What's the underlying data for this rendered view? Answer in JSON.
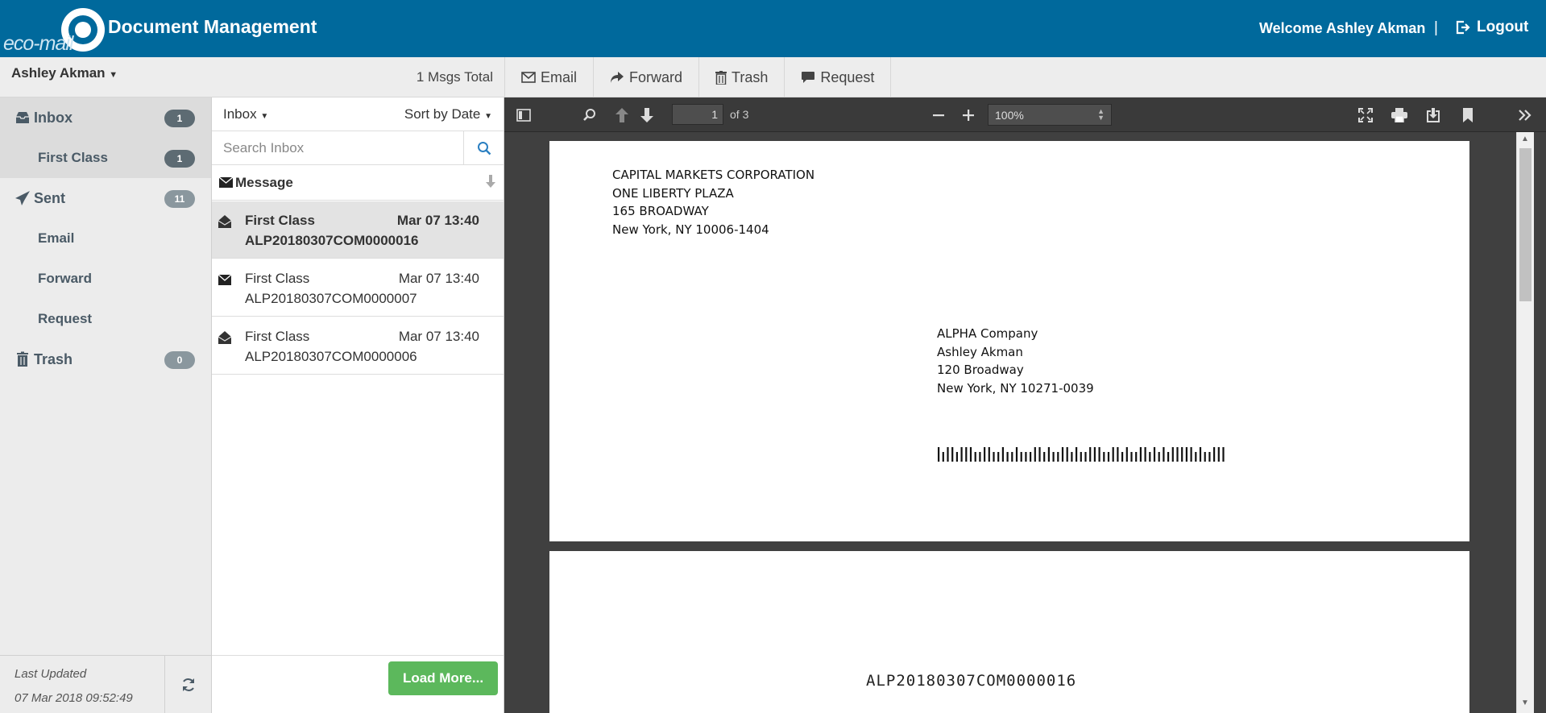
{
  "header": {
    "logo_text": "eco-mail",
    "title": "Document Management",
    "welcome": "Welcome Ashley Akman",
    "separator": "|",
    "logout": "Logout"
  },
  "toolbar": {
    "user": "Ashley Akman",
    "msgs_total": "1 Msgs Total",
    "actions": {
      "email": "Email",
      "forward": "Forward",
      "trash": "Trash",
      "request": "Request"
    }
  },
  "sidebar": {
    "inbox": {
      "label": "Inbox",
      "count": "1"
    },
    "first_class": {
      "label": "First Class",
      "count": "1"
    },
    "sent": {
      "label": "Sent",
      "count": "11"
    },
    "email": {
      "label": "Email"
    },
    "forward": {
      "label": "Forward"
    },
    "request": {
      "label": "Request"
    },
    "trash": {
      "label": "Trash",
      "count": "0"
    },
    "last_updated_label": "Last Updated",
    "last_updated_value": "07 Mar 2018 09:52:49"
  },
  "list": {
    "folder": "Inbox",
    "sort": "Sort by Date",
    "search_placeholder": "Search Inbox",
    "column": "Message",
    "rows": [
      {
        "title": "First Class",
        "date": "Mar 07 13:40",
        "id": "ALP20180307COM0000016",
        "read": true
      },
      {
        "title": "First Class",
        "date": "Mar 07 13:40",
        "id": "ALP20180307COM0000007",
        "read": false
      },
      {
        "title": "First Class",
        "date": "Mar 07 13:40",
        "id": "ALP20180307COM0000006",
        "read": true
      }
    ],
    "load_more": "Load More..."
  },
  "viewer": {
    "page_number": "1",
    "page_total": "of 3",
    "zoom": "100%",
    "sender": {
      "line1": "CAPITAL MARKETS CORPORATION",
      "line2": "ONE LIBERTY PLAZA",
      "line3": "165 BROADWAY",
      "line4": "New York, NY 10006-1404"
    },
    "recipient": {
      "line1": "ALPHA Company",
      "line2": "Ashley Akman",
      "line3": "120 Broadway",
      "line4": "New York, NY 10271-0039"
    },
    "page2_id": "ALP20180307COM0000016"
  },
  "colors": {
    "header": "#00699c",
    "badge": "#5d6b73",
    "load_more": "#5cb85c",
    "viewer_bg": "#404040"
  }
}
